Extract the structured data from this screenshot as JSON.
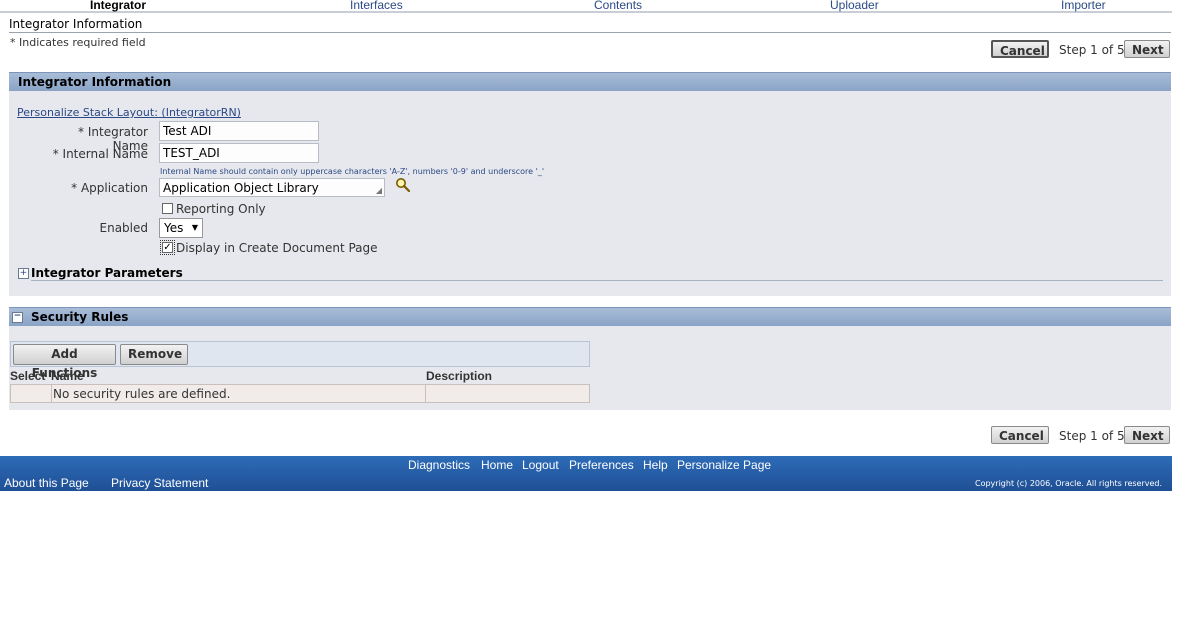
{
  "train": {
    "steps": [
      "Integrator",
      "Interfaces",
      "Contents",
      "Uploader",
      "Importer"
    ]
  },
  "page": {
    "title": "Integrator Information",
    "required_note": "* Indicates required field"
  },
  "nav": {
    "cancel_label": "Cancel",
    "step_text": "Step 1 of 5",
    "next_label": "Next"
  },
  "integrator_panel": {
    "header": "Integrator Information",
    "personalize_link": "Personalize Stack Layout: (IntegratorRN)",
    "fields": {
      "integrator_name_label": "Integrator Name",
      "integrator_name_value": "Test ADI",
      "internal_name_label": "Internal Name",
      "internal_name_value": "TEST_ADI",
      "internal_name_hint": "Internal Name should contain only uppercase characters 'A-Z', numbers '0-9' and underscore '_'",
      "application_label": "Application",
      "application_value": "Application Object Library",
      "reporting_only_label": "Reporting Only",
      "reporting_only_checked": false,
      "enabled_label": "Enabled",
      "enabled_value": "Yes",
      "display_create_doc_label": "Display in Create Document Page",
      "display_create_doc_checked": true
    },
    "params_header": "Integrator Parameters"
  },
  "security_panel": {
    "header": "Security Rules",
    "add_functions_label": "Add Functions",
    "remove_label": "Remove",
    "columns": [
      "Select",
      "Name",
      "Description"
    ],
    "empty_message": "No security rules are defined."
  },
  "footer": {
    "links": [
      "Diagnostics",
      "Home",
      "Logout",
      "Preferences",
      "Help",
      "Personalize Page"
    ],
    "about": "About this Page",
    "privacy": "Privacy Statement",
    "copyright": "Copyright (c) 2006, Oracle. All rights reserved."
  },
  "colors": {
    "panel_header": "#8aa3c6",
    "panel_bg": "#e7e8ed",
    "footer_bg": "#1f4f94",
    "link": "#2b4a86"
  }
}
